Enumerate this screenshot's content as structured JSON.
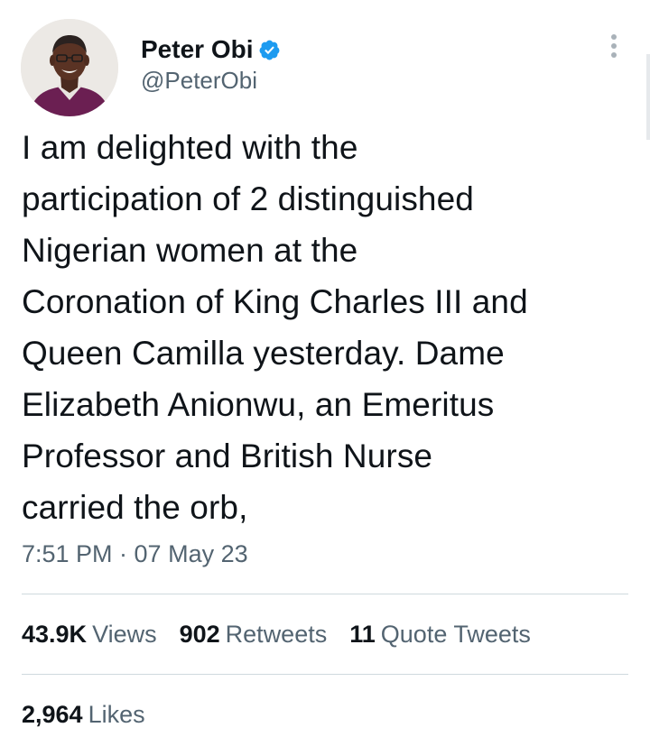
{
  "author": {
    "display_name": "Peter Obi",
    "handle": "@PeterObi",
    "verified": true,
    "avatar_icon": "profile-photo",
    "verified_color": "#1d9bf0"
  },
  "tweet": {
    "text": "I am delighted with the\nparticipation of 2 distinguished\nNigerian women at the\nCoronation of King Charles III and\nQueen Camilla yesterday. Dame\nElizabeth Anionwu, an Emeritus\nProfessor and British Nurse\ncarried the orb,",
    "timestamp": "7:51 PM · 07 May 23"
  },
  "stats": {
    "views": {
      "count": "43.9K",
      "label": "Views"
    },
    "retweets": {
      "count": "902",
      "label": "Retweets"
    },
    "quote_tweets": {
      "count": "11",
      "label": "Quote Tweets"
    },
    "likes": {
      "count": "2,964",
      "label": "Likes"
    }
  },
  "icons": {
    "more": "more-options-icon",
    "verified": "verified-badge-icon"
  },
  "colors": {
    "text_primary": "#0f1419",
    "text_secondary": "#536471",
    "divider": "#cfd9de"
  }
}
